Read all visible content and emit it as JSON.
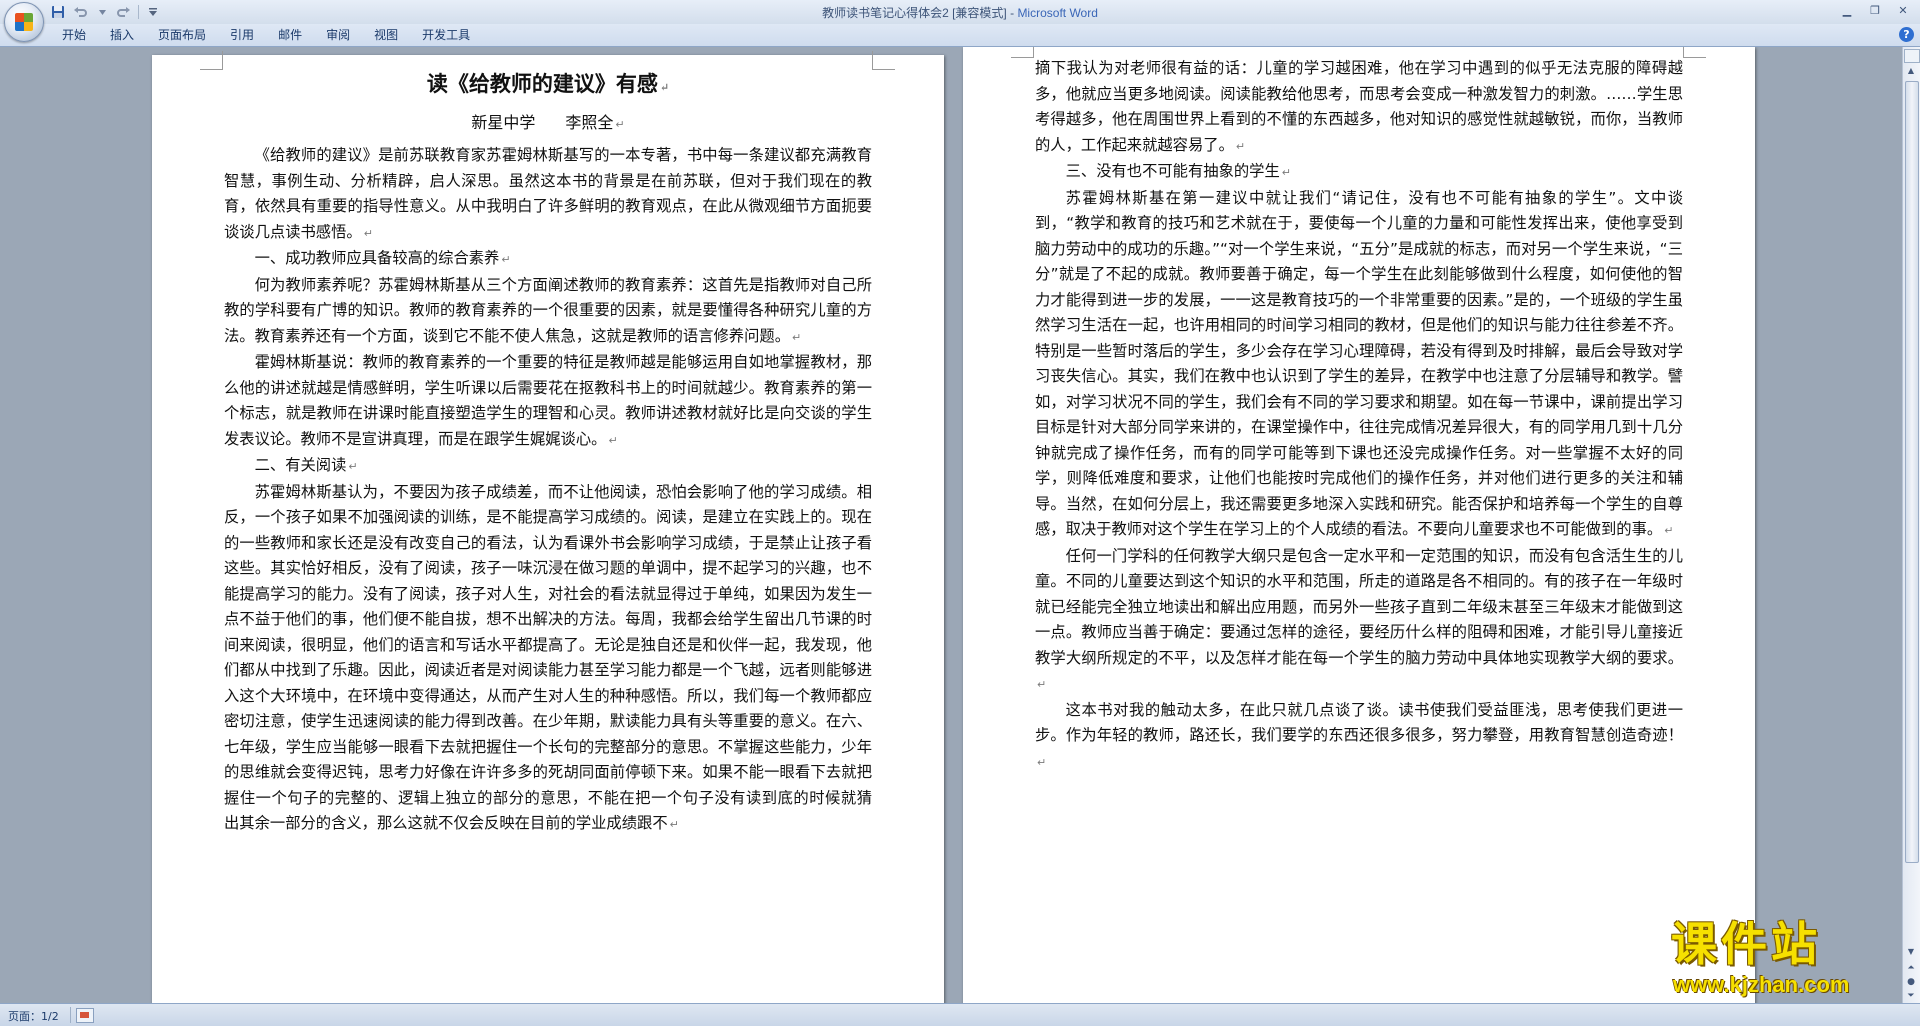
{
  "window": {
    "title_doc": "教师读书笔记心得体会2 [兼容模式] - ",
    "title_app": "Microsoft Word"
  },
  "quick_access": {
    "icons": [
      "save-icon",
      "undo-icon",
      "redo-icon",
      "customize-icon"
    ]
  },
  "ribbon_tabs": [
    "开始",
    "插入",
    "页面布局",
    "引用",
    "邮件",
    "审阅",
    "视图",
    "开发工具"
  ],
  "document": {
    "title": "读《给教师的建议》有感",
    "school": "新星中学",
    "author": "李照全",
    "left_page": [
      {
        "type": "para",
        "text": "《给教师的建议》是前苏联教育家苏霍姆林斯基写的一本专著，书中每一条建议都充满教育智慧，事例生动、分析精辟，启人深思。虽然这本书的背景是在前苏联，但对于我们现在的教育，依然具有重要的指导性意义。从中我明白了许多鲜明的教育观点，在此从微观细节方面扼要谈谈几点读书感悟。"
      },
      {
        "type": "heading",
        "text": "一、成功教师应具备较高的综合素养"
      },
      {
        "type": "para",
        "text": "何为教师素养呢？苏霍姆林斯基从三个方面阐述教师的教育素养：这首先是指教师对自己所教的学科要有广博的知识。教师的教育素养的一个很重要的因素，就是要懂得各种研究儿童的方法。教育素养还有一个方面，谈到它不能不使人焦急，这就是教师的语言修养问题。"
      },
      {
        "type": "para",
        "text": "霍姆林斯基说：教师的教育素养的一个重要的特征是教师越是能够运用自如地掌握教材，那么他的讲述就越是情感鲜明，学生听课以后需要花在抠教科书上的时间就越少。教育素养的第一个标志，就是教师在讲课时能直接塑造学生的理智和心灵。教师讲述教材就好比是向交谈的学生发表议论。教师不是宣讲真理，而是在跟学生娓娓谈心。"
      },
      {
        "type": "heading",
        "text": "二、有关阅读"
      },
      {
        "type": "para",
        "text": "苏霍姆林斯基认为，不要因为孩子成绩差，而不让他阅读，恐怕会影响了他的学习成绩。相反，一个孩子如果不加强阅读的训练，是不能提高学习成绩的。阅读，是建立在实践上的。现在的一些教师和家长还是没有改变自己的看法，认为看课外书会影响学习成绩，于是禁止让孩子看这些。其实恰好相反，没有了阅读，孩子一味沉浸在做习题的单调中，提不起学习的兴趣，也不能提高学习的能力。没有了阅读，孩子对人生，对社会的看法就显得过于单纯，如果因为发生一点不益于他们的事，他们便不能自拔，想不出解决的方法。每周，我都会给学生留出几节课的时间来阅读，很明显，他们的语言和写话水平都提高了。无论是独自还是和伙伴一起，我发现，他们都从中找到了乐趣。因此，阅读近者是对阅读能力甚至学习能力都是一个飞越，远者则能够进入这个大环境中，在环境中变得通达，从而产生对人生的种种感悟。所以，我们每一个教师都应密切注意，使学生迅速阅读的能力得到改善。在少年期，默读能力具有头等重要的意义。在六、七年级，学生应当能够一眼看下去就把握住一个长句的完整部分的意思。不掌握这些能力，少年的思维就会变得迟钝，思考力好像在许许多多的死胡同面前停顿下来。如果不能一眼看下去就把握住一个句子的完整的、逻辑上独立的部分的意思，不能在把一个句子没有读到底的时候就猜　出其余一部分的含义，那么这就不仅会反映在目前的学业成绩跟不"
      }
    ],
    "right_page": [
      {
        "type": "para_noindent",
        "text": "摘下我认为对老师很有益的话：儿童的学习越困难，他在学习中遇到的似乎无法克服的障碍越多，他就应当更多地阅读。阅读能教给他思考，而思考会变成一种激发智力的刺激。……学生思考得越多，他在周围世界上看到的不懂的东西越多，他对知识的感觉性就越敏锐，而你，当教师的人，工作起来就越容易了。"
      },
      {
        "type": "heading",
        "text": "三、没有也不可能有抽象的学生"
      },
      {
        "type": "para",
        "text": "苏霍姆林斯基在第一建议中就让我们“请记住，没有也不可能有抽象的学生”。文中谈到，“教学和教育的技巧和艺术就在于，要使每一个儿童的力量和可能性发挥出来，使他享受到脑力劳动中的成功的乐趣。”“对一个学生来说，“五分”是成就的标志，而对另一个学生来说，“三分”就是了不起的成就。教师要善于确定，每一个学生在此刻能够做到什么程度，如何使他的智力才能得到进一步的发展，一一这是教育技巧的一个非常重要的因素。”是的，一个班级的学生虽然学习生活在一起，也许用相同的时间学习相同的教材，但是他们的知识与能力往往参差不齐。特别是一些暂时落后的学生，多少会存在学习心理障碍，若没有得到及时排解，最后会导致对学习丧失信心。其实，我们在教中也认识到了学生的差异，在教学中也注意了分层辅导和教学。譬如，对学习状况不同的学生，我们会有不同的学习要求和期望。如在每一节课中，课前提出学习目标是针对大部分同学来讲的，在课堂操作中，往往完成情况差异很大，有的同学用几到十几分钟就完成了操作任务，而有的同学可能等到下课也还没完成操作任务。对一些掌握不太好的同学，则降低难度和要求，让他们也能按时完成他们的操作任务，并对他们进行更多的关注和辅导。当然，在如何分层上，我还需要更多地深入实践和研究。能否保护和培养每一个学生的自尊感，取决于教师对这个学生在学习上的个人成绩的看法。不要向儿童要求也不可能做到的事。"
      },
      {
        "type": "para",
        "text": "任何一门学科的任何教学大纲只是包含一定水平和一定范围的知识，而没有包含活生生的儿童。不同的儿童要达到这个知识的水平和范围，所走的道路是各不相同的。有的孩子在一年级时就已经能完全独立地读出和解出应用题，而另外一些孩子直到二年级末甚至三年级末才能做到这一点。教师应当善于确定：要通过怎样的途径，要经历什么样的阻碍和困难，才能引导儿童接近教学大纲所规定的不平，以及怎样才能在每一个学生的脑力劳动中具体地实现教学大纲的要求。"
      },
      {
        "type": "para",
        "text": "这本书对我的触动太多，在此只就几点谈了谈。读书使我们受益匪浅，思考使我们更进一步。作为年轻的教师，路还长，我们要学的东西还很多很多，努力攀登，用教育智慧创造奇迹！"
      }
    ]
  },
  "status_bar": {
    "pages": "页面：1/2"
  },
  "watermark": {
    "brand": "课件站",
    "url": "www.kjzhan.com"
  },
  "colors": {
    "app_title": "#3a66b7",
    "background": "#9ba7b6",
    "watermark": "#f6e000"
  }
}
